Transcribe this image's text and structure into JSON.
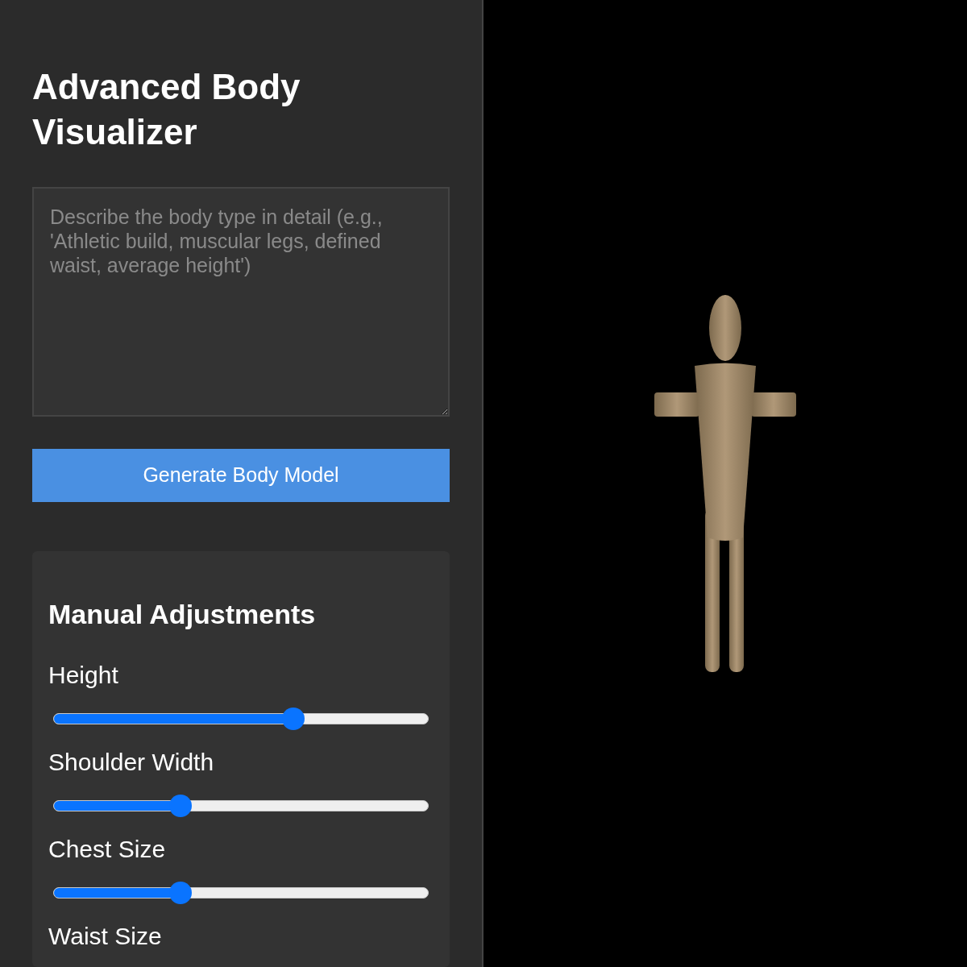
{
  "title": "Advanced Body Visualizer",
  "description": {
    "placeholder": "Describe the body type in detail (e.g., 'Athletic build, muscular legs, defined waist, average height')"
  },
  "generate_button": "Generate Body Model",
  "adjustments": {
    "title": "Manual Adjustments",
    "sliders": [
      {
        "label": "Height",
        "level": 0.64
      },
      {
        "label": "Shoulder Width",
        "level": 0.34
      },
      {
        "label": "Chest Size",
        "level": 0.34
      },
      {
        "label": "Waist Size"
      }
    ]
  }
}
